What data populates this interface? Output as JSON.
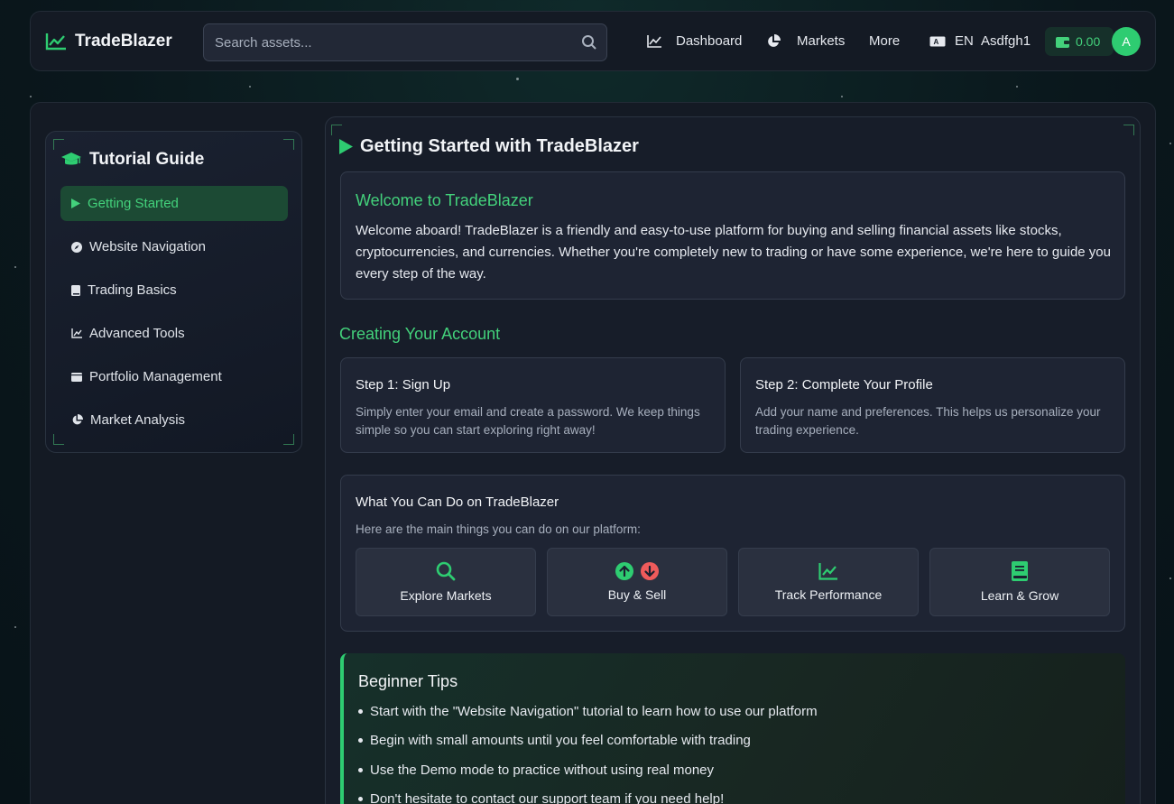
{
  "header": {
    "brand": "TradeBlazer",
    "search_placeholder": "Search assets...",
    "nav": {
      "dashboard": "Dashboard",
      "markets": "Markets",
      "more": "More",
      "language": "EN",
      "username": "Asdfgh1"
    },
    "wallet_balance": "0.00",
    "avatar_initial": "A",
    "accent_color": "#2ecc71"
  },
  "sidebar": {
    "title": "Tutorial Guide",
    "items": [
      {
        "label": "Getting Started",
        "icon": "play-icon",
        "active": true
      },
      {
        "label": "Website Navigation",
        "icon": "compass-icon",
        "active": false
      },
      {
        "label": "Trading Basics",
        "icon": "book-icon",
        "active": false
      },
      {
        "label": "Advanced Tools",
        "icon": "chart-line-icon",
        "active": false
      },
      {
        "label": "Portfolio Management",
        "icon": "wallet-icon",
        "active": false
      },
      {
        "label": "Market Analysis",
        "icon": "pie-chart-icon",
        "active": false
      }
    ]
  },
  "main": {
    "title": "Getting Started with TradeBlazer",
    "welcome": {
      "heading": "Welcome to TradeBlazer",
      "body": "Welcome aboard! TradeBlazer is a friendly and easy-to-use platform for buying and selling financial assets like stocks, cryptocurrencies, and currencies. Whether you're completely new to trading or have some experience, we're here to guide you every step of the way."
    },
    "account_heading": "Creating Your Account",
    "steps": [
      {
        "title": "Step 1: Sign Up",
        "body": "Simply enter your email and create a password. We keep things simple so you can start exploring right away!"
      },
      {
        "title": "Step 2: Complete Your Profile",
        "body": "Add your name and preferences. This helps us personalize your trading experience."
      }
    ],
    "can_do": {
      "title": "What You Can Do on TradeBlazer",
      "subtitle": "Here are the main things you can do on our platform:",
      "tiles": [
        {
          "label": "Explore Markets",
          "icon": "search-icon"
        },
        {
          "label": "Buy & Sell",
          "icon": "arrow-up-down-icon"
        },
        {
          "label": "Track Performance",
          "icon": "chart-line-icon"
        },
        {
          "label": "Learn & Grow",
          "icon": "book-icon"
        }
      ]
    },
    "tips": {
      "title": "Beginner Tips",
      "items": [
        "Start with the \"Website Navigation\" tutorial to learn how to use our platform",
        "Begin with small amounts until you feel comfortable with trading",
        "Use the Demo mode to practice without using real money",
        "Don't hesitate to contact our support team if you need help!"
      ]
    }
  }
}
